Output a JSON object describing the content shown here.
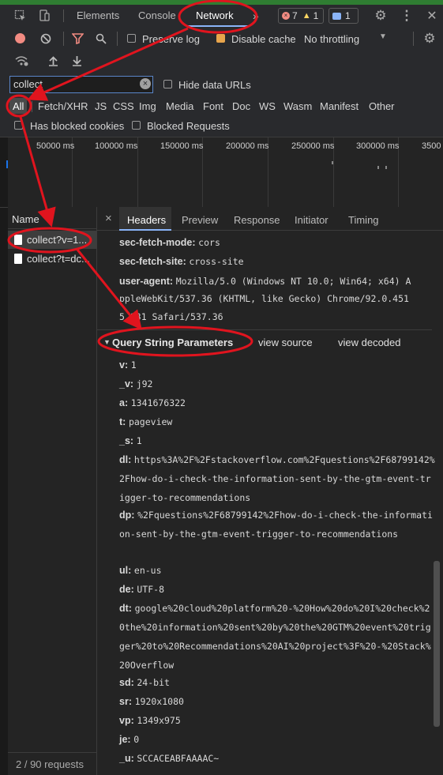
{
  "tabs": {
    "elements": "Elements",
    "console": "Console",
    "network": "Network"
  },
  "counters": {
    "errors": "7",
    "warnings": "1",
    "messages": "1"
  },
  "toolbar": {
    "preserve_log": "Preserve log",
    "disable_cache": "Disable cache",
    "throttle": "No throttling"
  },
  "filter": {
    "value": "collect",
    "hide_data_urls": "Hide data URLs",
    "has_blocked_cookies": "Has blocked cookies",
    "blocked_requests": "Blocked Requests"
  },
  "types": [
    "All",
    "Fetch/XHR",
    "JS",
    "CSS",
    "Img",
    "Media",
    "Font",
    "Doc",
    "WS",
    "Wasm",
    "Manifest",
    "Other"
  ],
  "timeline": [
    "50000 ms",
    "100000 ms",
    "150000 ms",
    "200000 ms",
    "250000 ms",
    "300000 ms",
    "3500"
  ],
  "list": {
    "header": "Name",
    "items": [
      "collect?v=1...",
      "collect?t=dc..."
    ],
    "status": "2 / 90 requests"
  },
  "detail": {
    "tabs": {
      "close": "×",
      "headers": "Headers",
      "preview": "Preview",
      "response": "Response",
      "initiator": "Initiator",
      "timing": "Timing"
    },
    "headers": [
      {
        "key": "sec-fetch-mode:",
        "value": "cors"
      },
      {
        "key": "sec-fetch-site:",
        "value": "cross-site"
      },
      {
        "key": "user-agent:",
        "value": "Mozilla/5.0 (Windows NT 10.0; Win64; x64) A",
        "cont1": "ppleWebKit/537.36 (KHTML, like Gecko) Chrome/92.0.451",
        "cont2": "5.131 Safari/537.36"
      }
    ],
    "qs_title": "Query String Parameters",
    "view_source": "view source",
    "view_decoded": "view decoded",
    "params": [
      {
        "key": "v:",
        "value": "1"
      },
      {
        "key": "_v:",
        "value": "j92"
      },
      {
        "key": "a:",
        "value": "1341676322"
      },
      {
        "key": "t:",
        "value": "pageview"
      },
      {
        "key": "_s:",
        "value": "1"
      },
      {
        "key": "dl:",
        "value": "https%3A%2F%2Fstackoverflow.com%2Fquestions%2F68799142%2Fhow-do-i-check-the-information-sent-by-the-gtm-event-trigger-to-recommendations"
      },
      {
        "key": "dp:",
        "value": "%2Fquestions%2F68799142%2Fhow-do-i-check-the-information-sent-by-the-gtm-event-trigger-to-recommendations"
      },
      {
        "key": "ul:",
        "value": "en-us"
      },
      {
        "key": "de:",
        "value": "UTF-8"
      },
      {
        "key": "dt:",
        "value": "google%20cloud%20platform%20-%20How%20do%20I%20check%20the%20information%20sent%20by%20the%20GTM%20event%20trigger%20to%20Recommendations%20AI%20project%3F%20-%20Stack%20Overflow"
      },
      {
        "key": "sd:",
        "value": "24-bit"
      },
      {
        "key": "sr:",
        "value": "1920x1080"
      },
      {
        "key": "vp:",
        "value": "1349x975"
      },
      {
        "key": "je:",
        "value": "0"
      },
      {
        "key": "_u:",
        "value": "SCCACEABFAAAAC~"
      }
    ]
  },
  "colors": {
    "annotation": "#e0141e",
    "accent": "#8ab4f8",
    "record": "#f28b82"
  }
}
